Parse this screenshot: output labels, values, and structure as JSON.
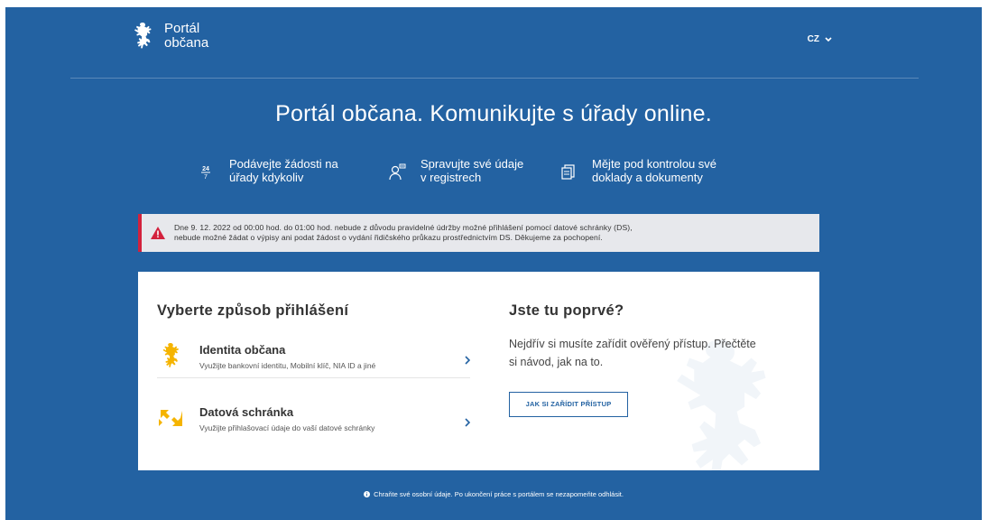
{
  "header": {
    "logo_line1": "Portál",
    "logo_line2": "občana",
    "lang": "CZ"
  },
  "hero": {
    "title": "Portál občana. Komunikujte s úřady online."
  },
  "features": [
    {
      "icon": "24-7-icon",
      "line1": "Podávejte žádosti na",
      "line2": "úřady kdykoliv"
    },
    {
      "icon": "user-registry-icon",
      "line1": "Spravujte své údaje",
      "line2": "v registrech"
    },
    {
      "icon": "documents-icon",
      "line1": "Mějte pod kontrolou své",
      "line2": "doklady a dokumenty"
    }
  ],
  "alert": {
    "line1": "Dne 9. 12. 2022 od 00:00 hod. do 01:00 hod. nebude z důvodu pravidelné údržby možné přihlášení pomocí datové schránky (DS),",
    "line2": "nebude možné žádat o výpisy ani podat žádost o vydání řidičského průkazu prostřednictvím DS. Děkujeme za pochopení."
  },
  "login": {
    "title": "Vyberte způsob přihlášení",
    "options": [
      {
        "title": "Identita občana",
        "subtitle": "Využijte bankovní identitu, Mobilní klíč, NIA ID a jiné"
      },
      {
        "title": "Datová schránka",
        "subtitle": "Využijte přihlašovací údaje do vaší datové schránky"
      }
    ]
  },
  "first_time": {
    "title": "Jste tu poprvé?",
    "text_line1": "Nejdřív si musíte zařídit ověřený přístup. Přečtěte",
    "text_line2": "si návod, jak na to.",
    "button": "JAK SI ZAŘÍDIT PŘÍSTUP"
  },
  "footer": {
    "note": "Chraňte své osobní údaje. Po ukončení práce s portálem se nezapomeňte odhlásit."
  },
  "colors": {
    "brand_blue": "#2362a2",
    "alert_red": "#d3213d",
    "gold": "#f5b400"
  }
}
